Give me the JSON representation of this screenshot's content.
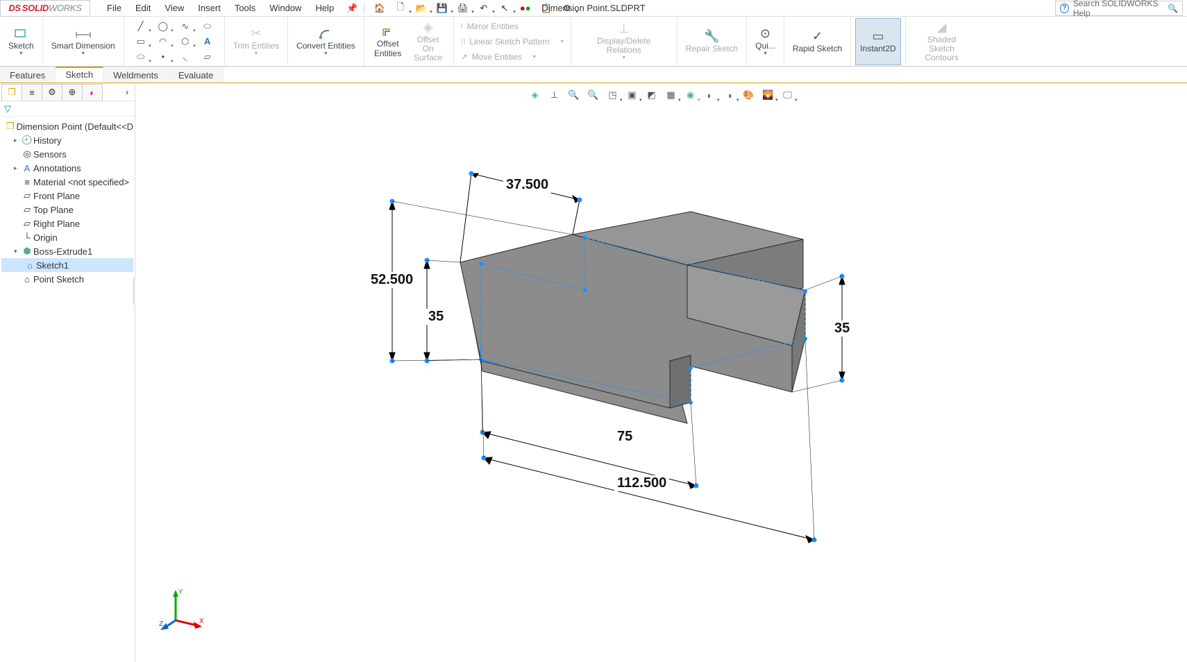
{
  "app": {
    "brand_red": "SOLID",
    "brand_grey": "WORKS",
    "title": "Dimension Point.SLDPRT",
    "search_placeholder": "Search SOLIDWORKS Help"
  },
  "menus": [
    "File",
    "Edit",
    "View",
    "Insert",
    "Tools",
    "Window",
    "Help"
  ],
  "ribbon": {
    "sketch": "Sketch",
    "smart_dim": "Smart Dimension",
    "trim": "Trim Entities",
    "convert": "Convert Entities",
    "offset": "Offset Entities",
    "offset_on": "Offset On Surface",
    "mirror": "Mirror Entities",
    "pattern": "Linear Sketch Pattern",
    "move": "Move Entities",
    "display_rel": "Display/Delete Relations",
    "repair": "Repair Sketch",
    "quick": "Qui...",
    "rapid": "Rapid Sketch",
    "instant2d": "Instant2D",
    "shaded": "Shaded Sketch Contours"
  },
  "tabs": [
    "Features",
    "Sketch",
    "Weldments",
    "Evaluate"
  ],
  "tree": {
    "root": "Dimension Point  (Default<<D",
    "history": "History",
    "sensors": "Sensors",
    "annotations": "Annotations",
    "material": "Material <not specified>",
    "front": "Front Plane",
    "top": "Top Plane",
    "right": "Right Plane",
    "origin": "Origin",
    "boss": "Boss-Extrude1",
    "sketch1": "Sketch1",
    "pointsketch": "Point Sketch"
  },
  "dims": {
    "d1": "37.500",
    "d2": "52.500",
    "d3": "35",
    "d4": "35",
    "d5": "75",
    "d6": "112.500"
  },
  "triad": {
    "x": "X",
    "y": "Y",
    "z": "Z"
  }
}
